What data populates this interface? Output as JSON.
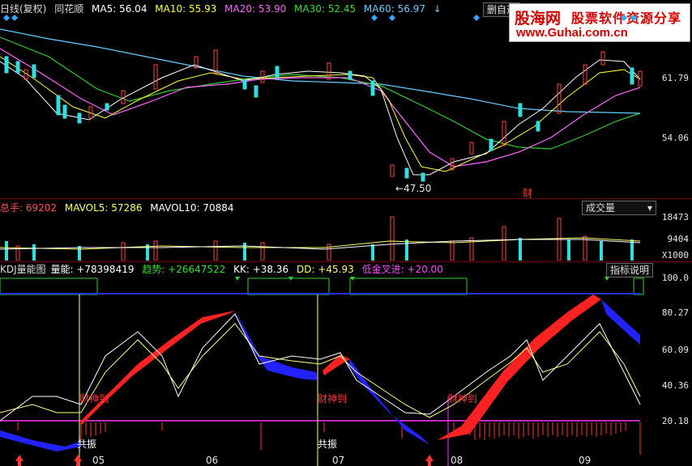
{
  "kline_header": {
    "title": "日线(复权)",
    "stock": "同花顺",
    "ma5": "MA5: 56.04",
    "ma10": "MA10: 55.93",
    "ma20": "MA20: 53.90",
    "ma30": "MA30: 52.45",
    "ma60": "MA60: 56.97",
    "delete_label": "删自选",
    "colors": {
      "ma5": "#ffffff",
      "ma10": "#ffff00",
      "ma20": "#ff66ff",
      "ma30": "#33cc33",
      "ma60": "#66ccff"
    }
  },
  "watermark": {
    "logo": "股海网",
    "slogan": "股票软件资源分享",
    "url": "www.Guhai.com.cn"
  },
  "price_axis": {
    "high": "61.79",
    "mid": "54.06"
  },
  "low_marker": "←47.50",
  "cai_marker": "财",
  "volume_header": {
    "total": "总手: 69202",
    "mavol5": "MAVOL5: 57286",
    "mavol10": "MAVOL10: 70884",
    "dropdown_label": "成交量",
    "axis": [
      "18473",
      "9404",
      "X1000"
    ]
  },
  "indicator_header": {
    "name": "KDJ量能图",
    "liangneng": "量能: +78398419",
    "qushi": "趋势: +26647522",
    "kk": "KK: +38.36",
    "dd": "DD: +45.93",
    "jincha": "低金叉进: +20.00",
    "help_button": "指标说明",
    "axis": [
      "100.0",
      "80.27",
      "60.09",
      "40.36",
      "20.18"
    ]
  },
  "signals": {
    "caishen": [
      "财神到",
      "财神到",
      "财神到"
    ],
    "gongzhen": [
      "共振",
      "共振"
    ]
  },
  "time_axis": [
    "05",
    "06",
    "07",
    "08",
    "09"
  ]
}
